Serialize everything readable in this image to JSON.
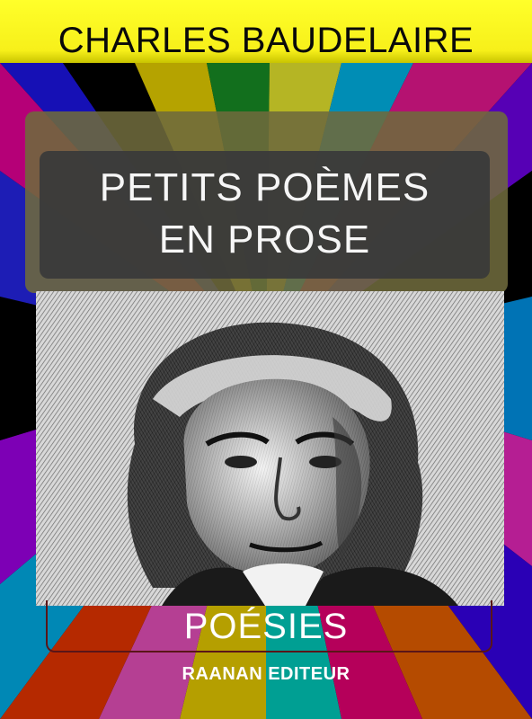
{
  "author": "CHARLES BAUDELAIRE",
  "title": {
    "line1": "PETITS POÈMES",
    "line2": "EN PROSE"
  },
  "genre": "POÉSIES",
  "publisher": "RAANAN EDITEUR",
  "colors": {
    "author_band": "#ffff2a",
    "title_panel": "#6e6a3c",
    "title_inner": "#3a3a3a",
    "background": "#000000",
    "text_light": "#ffffff"
  },
  "portrait": {
    "icon": "engraved-portrait-image"
  }
}
